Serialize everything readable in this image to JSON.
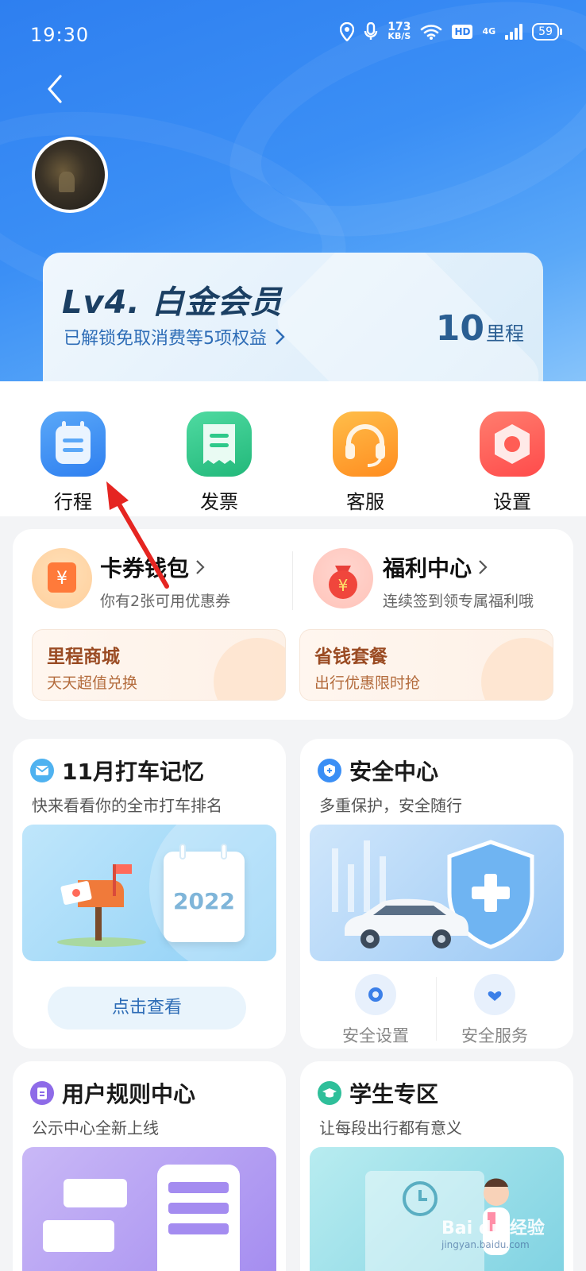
{
  "status": {
    "time": "19:30",
    "net_speed": "173",
    "net_unit": "KB/S",
    "hd": "HD",
    "network": "4G",
    "battery": "59"
  },
  "member": {
    "level": "Lv4. 白金会员",
    "benefit": "已解锁免取消费等5项权益",
    "mileage_value": "10",
    "mileage_unit": "里程"
  },
  "quick_actions": [
    {
      "label": "行程",
      "icon": "calendar-icon",
      "color": "#3b8ff5"
    },
    {
      "label": "发票",
      "icon": "receipt-icon",
      "color": "#2ec98a"
    },
    {
      "label": "客服",
      "icon": "headset-icon",
      "color": "#ff9d2e"
    },
    {
      "label": "设置",
      "icon": "settings-icon",
      "color": "#ff5d55"
    }
  ],
  "wallet": {
    "coupon": {
      "title": "卡券钱包",
      "subtitle": "你有2张可用优惠券"
    },
    "welfare": {
      "title": "福利中心",
      "subtitle": "连续签到领专属福利哦"
    },
    "mall": {
      "title": "里程商城",
      "subtitle": "天天超值兑换"
    },
    "package": {
      "title": "省钱套餐",
      "subtitle": "出行优惠限时抢"
    }
  },
  "cards": {
    "memory": {
      "title": "11月打车记忆",
      "subtitle": "快来看看你的全市打车排名",
      "image_text": "2022",
      "button": "点击查看"
    },
    "safety": {
      "title": "安全中心",
      "subtitle": "多重保护，安全随行",
      "setting": "安全设置",
      "service": "安全服务"
    },
    "rules": {
      "title": "用户规则中心",
      "subtitle": "公示中心全新上线"
    },
    "student": {
      "title": "学生专区",
      "subtitle": "让每段出行都有意义"
    }
  },
  "watermark": {
    "brand": "Bai du 经验",
    "url": "jingyan.baidu.com"
  },
  "colors": {
    "accent": "#2e7ff0",
    "arrow": "#e52521"
  }
}
